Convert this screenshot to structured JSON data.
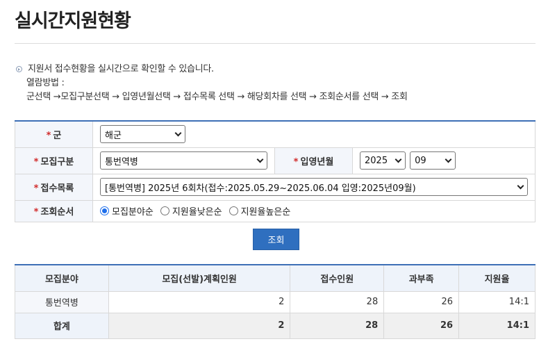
{
  "page": {
    "title": "실시간지원현황"
  },
  "info": {
    "line1": "지원서 접수현황을 실시간으로 확인할 수 있습니다.",
    "line2": "열람방법 :",
    "line3": "군선택 →모집구분선택 → 입영년월선택 → 접수목록 선택 → 해당회차를 선택 → 조회순서를 선택 → 조회"
  },
  "form": {
    "required_mark": "*",
    "army": {
      "label": "군",
      "value": "해군"
    },
    "category": {
      "label": "모집구분",
      "value": "통번역병"
    },
    "enlist": {
      "label": "입영년월",
      "year": "2025",
      "month": "09"
    },
    "reception": {
      "label": "접수목록",
      "value": "[통번역병] 2025년 6회차(접수:2025.05.29~2025.06.04 입영:2025년09월)"
    },
    "order": {
      "label": "조회순서",
      "options": [
        "모집분야순",
        "지원율낮은순",
        "지원율높은순"
      ],
      "selected": 0
    }
  },
  "search_button": {
    "label": "조회"
  },
  "result_table": {
    "headers": [
      "모집분야",
      "모집(선발)계획인원",
      "접수인원",
      "과부족",
      "지원율"
    ],
    "rows": [
      {
        "field": "통번역병",
        "plan": "2",
        "applied": "28",
        "diff": "26",
        "rate": "14:1"
      }
    ],
    "total": {
      "field": "합계",
      "plan": "2",
      "applied": "28",
      "diff": "26",
      "rate": "14:1"
    }
  }
}
